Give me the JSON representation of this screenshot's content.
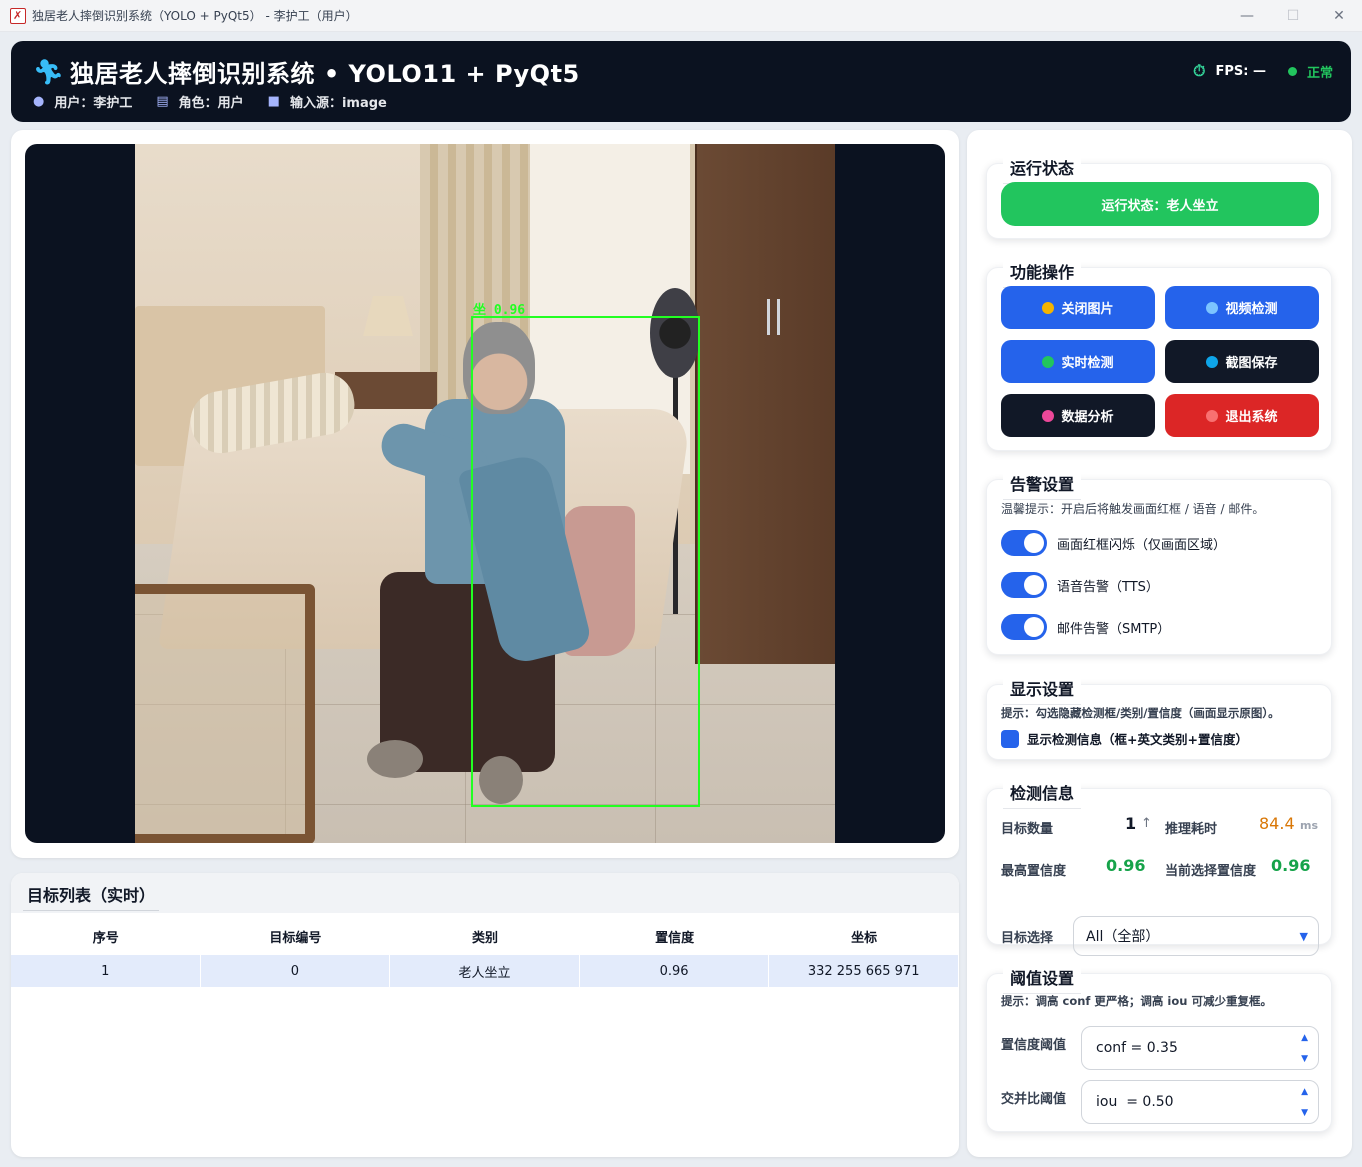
{
  "window": {
    "title": "独居老人摔倒识别系统（YOLO + PyQt5） - 李护工（用户）",
    "controls": [
      "—",
      "☐",
      "✕"
    ]
  },
  "header": {
    "title": "独居老人摔倒识别系统 • YOLO11 + PyQt5",
    "user_label": "用户：李护工",
    "role_label": "角色：用户",
    "source_label": "输入源：image",
    "fps_label": "FPS: —",
    "status_label": "正常",
    "status_color": "#22c55e"
  },
  "viewer": {
    "detection_label": "坐 0.96",
    "box_color": "#22ff22"
  },
  "run_status": {
    "title": "运行状态",
    "text": "运行状态：老人坐立"
  },
  "functions": {
    "title": "功能操作",
    "buttons": [
      {
        "label": "关闭图片",
        "dot": "#f5b400"
      },
      {
        "label": "视频检测",
        "dot": "#7cc4ff"
      },
      {
        "label": "实时检测",
        "dot": "#22c55e"
      },
      {
        "label": "截图保存",
        "dot": "#0ea5e9"
      },
      {
        "label": "数据分析",
        "dot": "#ec4899"
      },
      {
        "label": "退出系统",
        "dot": "#f87171"
      }
    ]
  },
  "alarm": {
    "title": "告警设置",
    "hint": "温馨提示：开启后将触发画面红框 / 语音 / 邮件。",
    "toggles": [
      {
        "label": "画面红框闪烁（仅画面区域）",
        "on": true
      },
      {
        "label": "语音告警（TTS）",
        "on": true
      },
      {
        "label": "邮件告警（SMTP）",
        "on": true
      }
    ]
  },
  "display": {
    "title": "显示设置",
    "hint": "提示：勾选隐藏检测框/类别/置信度（画面显示原图）。",
    "checkbox_label": "显示检测信息（框+英文类别+置信度）"
  },
  "detect_info": {
    "title": "检测信息",
    "count_label": "目标数量",
    "count_value": "1",
    "count_arrow": "↑",
    "time_label": "推理耗时",
    "time_value": "84.4",
    "time_unit": "ms",
    "max_conf_label": "最高置信度",
    "max_conf_value": "0.96",
    "cur_conf_label": "当前选择置信度",
    "cur_conf_value": "0.96",
    "target_select_label": "目标选择",
    "target_select_value": "All（全部）"
  },
  "threshold": {
    "title": "阈值设置",
    "hint": "提示：调高 conf 更严格；调高 iou 可减少重复框。",
    "conf_label": "置信度阈值",
    "conf_value": "conf = 0.35",
    "iou_label": "交并比阈值",
    "iou_value": "iou  = 0.50"
  },
  "table": {
    "title": "目标列表（实时）",
    "columns": [
      "序号",
      "目标编号",
      "类别",
      "置信度",
      "坐标"
    ],
    "rows": [
      [
        "1",
        "0",
        "老人坐立",
        "0.96",
        "332 255 665 971"
      ]
    ]
  }
}
